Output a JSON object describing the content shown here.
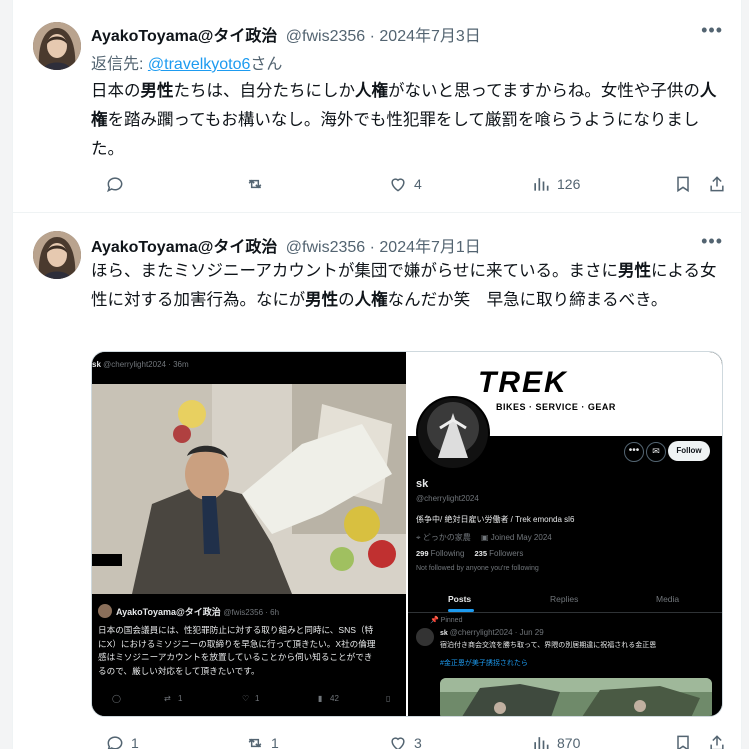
{
  "tweet1": {
    "name": "AyakoToyama@タイ政治",
    "meta": "@fwis2356 · 2024年7月3日",
    "reply_prefix": "返信先: ",
    "reply_handle": "@travelkyoto6",
    "reply_suffix": "さん",
    "body_parts": [
      {
        "t": "日本の",
        "b": false
      },
      {
        "t": "男性",
        "b": true
      },
      {
        "t": "たちは、自分たちにしか",
        "b": false
      },
      {
        "t": "人権",
        "b": true
      },
      {
        "t": "がないと思ってますからね。女性や子供の",
        "b": false
      },
      {
        "t": "人権",
        "b": true
      },
      {
        "t": "を踏み躙ってもお構いなし。海外でも性犯罪をして厳罰を喰らうようになりました。",
        "b": false
      }
    ],
    "actions": {
      "reply": "",
      "retweet": "",
      "like": "4",
      "views": "126"
    }
  },
  "tweet2": {
    "name": "AyakoToyama@タイ政治",
    "meta": "@fwis2356 · 2024年7月1日",
    "body_parts": [
      {
        "t": "ほら、またミソジニーアカウントが集団で嫌がらせに来ている。まさに",
        "b": false
      },
      {
        "t": "男性",
        "b": true
      },
      {
        "t": "による女性に対する加害行為。なにが",
        "b": false
      },
      {
        "t": "男性",
        "b": true
      },
      {
        "t": "の",
        "b": false
      },
      {
        "t": "人権",
        "b": true
      },
      {
        "t": "なんだか笑　早急に取り締まるべき。",
        "b": false
      }
    ],
    "actions": {
      "reply": "1",
      "retweet": "1",
      "like": "3",
      "views": "870"
    },
    "media": {
      "left": {
        "top_user": "sk",
        "top_meta": "@cherrylight2024 · 36m",
        "quote_name": "AyakoToyama@タイ政治",
        "quote_meta": "@fwis2356 · 6h",
        "quote_lines": [
          "日本の国会議員には、性犯罪防止に対する取り組みと同時に、SNS（特",
          "にX）におけるミソジニーの取締りを早急に行って頂きたい。X社の倫理",
          "感はミソジニーアカウントを放置していることから伺い知ることができ",
          "るので、厳しい対応をして頂きたいです。"
        ],
        "stats": {
          "reply": "",
          "retweet": "1",
          "like": "1",
          "views": "42"
        }
      },
      "right": {
        "banner_logo": "TREK",
        "banner_tagline": "BIKES · SERVICE · GEAR",
        "follow_label": "Follow",
        "display_name": "sk",
        "handle": "@cherrylight2024",
        "bio": "係争中/ 絶対日雇い労働者 / Trek emonda sl6",
        "location": "どっかの家農",
        "joined": "Joined May 2024",
        "following_count": "299",
        "following_label": "Following",
        "followers_count": "235",
        "followers_label": "Followers",
        "not_followed": "Not followed by anyone you're following",
        "tabs": [
          "Posts",
          "Replies",
          "Media"
        ],
        "pinned_label": "Pinned",
        "pinned_user": "sk",
        "pinned_meta": "@cherrylight2024 · Jun 29",
        "pinned_text": "宿泊付き商会交流を勝ち取って、界隈の別居期違に祝福される金正恩",
        "pinned_tag": "#金正恩が美子誘拐されたら"
      }
    }
  },
  "colors": {
    "link": "#1d9bf0",
    "muted": "#536471",
    "text": "#0f1419"
  }
}
